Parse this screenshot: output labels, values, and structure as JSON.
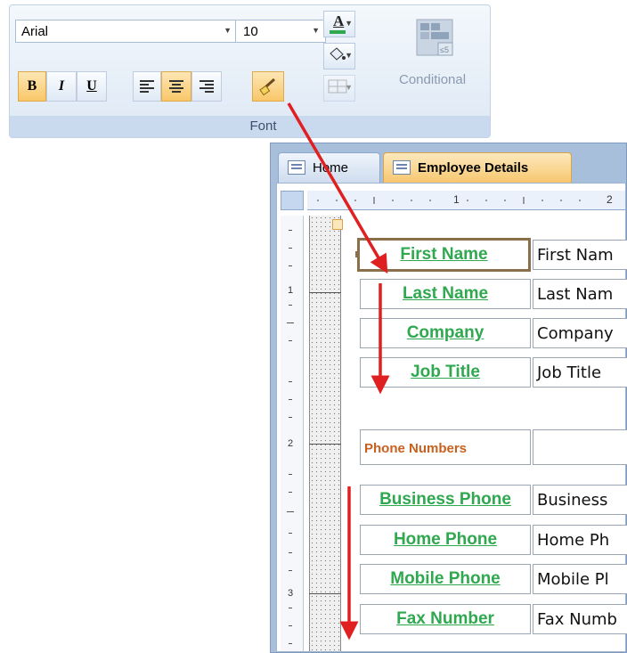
{
  "ribbon": {
    "font_name": "Arial",
    "font_size": "10",
    "bold_label": "B",
    "italic_label": "I",
    "underline_label": "U",
    "conditional_label": "Conditional",
    "group_label": "Font",
    "font_color_label": "A"
  },
  "tabs": [
    {
      "label": "Home"
    },
    {
      "label": "Employee Details"
    }
  ],
  "ruler": {
    "h_marks": [
      "1",
      "2"
    ],
    "v_marks": [
      "1",
      "2",
      "3"
    ]
  },
  "labels": {
    "first_name": "First Name",
    "last_name": "Last Name",
    "company": "Company",
    "job_title": "Job Title",
    "phone_numbers": "Phone Numbers",
    "business_phone": "Business Phone",
    "home_phone": "Home Phone",
    "mobile_phone": "Mobile Phone",
    "fax_number": "Fax Number"
  },
  "fields": {
    "first_name": "First Nam",
    "last_name": "Last Nam",
    "company": "Company",
    "job_title": "Job Title",
    "business_phone": "Business",
    "home_phone": "Home Ph",
    "mobile_phone": "Mobile Pl",
    "fax_number": "Fax Numb"
  },
  "colors": {
    "label_green": "#2fa84f",
    "section_orange": "#c8601e",
    "arrow_red": "#e02020",
    "selected_border": "#8a6f4a"
  }
}
